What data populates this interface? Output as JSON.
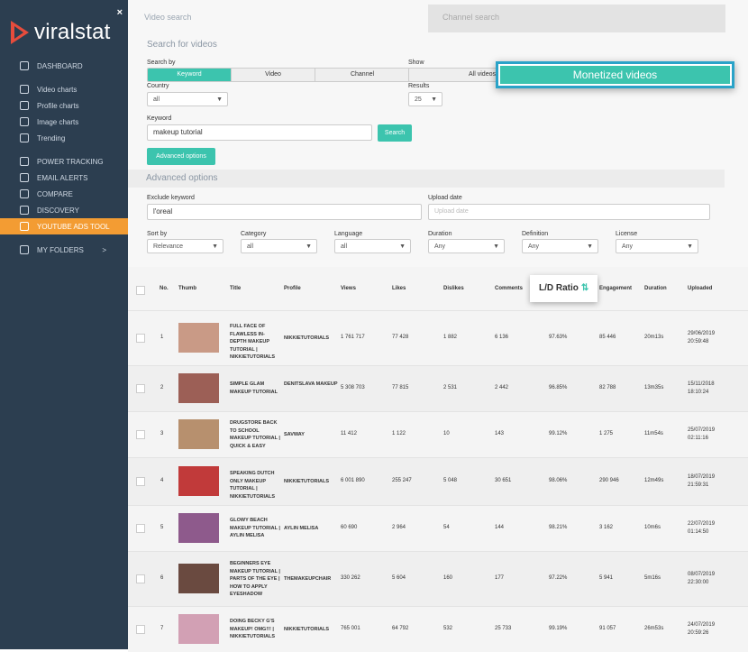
{
  "sidebar": {
    "logo_text": "viralstat",
    "close_label": "×",
    "items": [
      {
        "label": "DASHBOARD",
        "icon": "dashboard-icon",
        "active": false
      },
      {
        "label": "Video charts",
        "icon": "video-chart-icon",
        "active": false
      },
      {
        "label": "Profile charts",
        "icon": "profile-chart-icon",
        "active": false
      },
      {
        "label": "Image charts",
        "icon": "image-chart-icon",
        "active": false
      },
      {
        "label": "Trending",
        "icon": "trending-icon",
        "active": false
      },
      {
        "label": "POWER TRACKING",
        "icon": "power-icon",
        "active": false
      },
      {
        "label": "EMAIL ALERTS",
        "icon": "mail-icon",
        "active": false
      },
      {
        "label": "COMPARE",
        "icon": "compare-icon",
        "active": false
      },
      {
        "label": "DISCOVERY",
        "icon": "discovery-icon",
        "active": false
      },
      {
        "label": "YOUTUBE ADS TOOL",
        "icon": "youtube-icon",
        "active": true
      },
      {
        "label": "MY FOLDERS",
        "icon": "folder-icon",
        "active": false
      }
    ],
    "folders_arrow": ">"
  },
  "tabs": {
    "video": "Video search",
    "channel": "Channel search"
  },
  "search": {
    "title": "Search for videos",
    "search_by_label": "Search by",
    "search_by_options": [
      "Keyword",
      "Video",
      "Channel"
    ],
    "show_label": "Show",
    "show_options": [
      "All videos"
    ],
    "monetized_label": "Monetized videos",
    "country_label": "Country",
    "country_value": "all",
    "results_label": "Results",
    "results_value": "25",
    "keyword_label": "Keyword",
    "keyword_value": "makeup tutorial",
    "search_button": "Search",
    "advanced_button": "Advanced options"
  },
  "advanced": {
    "title": "Advanced options",
    "exclude_label": "Exclude keyword",
    "exclude_value": "l'oreal",
    "upload_label": "Upload date",
    "upload_placeholder": "Upload date",
    "filters": [
      {
        "label": "Sort by",
        "value": "Relevance"
      },
      {
        "label": "Category",
        "value": "all"
      },
      {
        "label": "Language",
        "value": "all"
      },
      {
        "label": "Duration",
        "value": "Any"
      },
      {
        "label": "Definition",
        "value": "Any"
      },
      {
        "label": "License",
        "value": "Any"
      }
    ]
  },
  "table": {
    "headers": {
      "no": "No.",
      "thumb": "Thumb",
      "title": "Title",
      "profile": "Profile",
      "views": "Views",
      "likes": "Likes",
      "dislikes": "Dislikes",
      "comments": "Comments",
      "ld": "L/D Ratio",
      "engagement": "Engagement",
      "duration": "Duration",
      "uploaded": "Uploaded"
    },
    "rows": [
      {
        "no": "1",
        "title": "FULL FACE OF FLAWLESS IN-DEPTH MAKEUP TUTORIAL | NIKKIETUTORIALS",
        "profile": "NIKKIETUTORIALS",
        "views": "1 761 717",
        "likes": "77 428",
        "dislikes": "1 882",
        "comments": "6 136",
        "ld": "97.63%",
        "engagement": "85 446",
        "duration": "20m13s",
        "uploaded_date": "29/06/2019",
        "uploaded_time": "20:59:48",
        "thumb_color": "#c99a86"
      },
      {
        "no": "2",
        "title": "SIMPLE GLAM MAKEUP TUTORIAL",
        "profile": "DENITSLAVA MAKEUP",
        "views": "5 308 703",
        "likes": "77 815",
        "dislikes": "2 531",
        "comments": "2 442",
        "ld": "96.85%",
        "engagement": "82 788",
        "duration": "13m35s",
        "uploaded_date": "15/11/2018",
        "uploaded_time": "18:10:24",
        "thumb_color": "#9c5f56"
      },
      {
        "no": "3",
        "title": "DRUGSTORE BACK TO SCHOOL MAKEUP TUTORIAL | QUICK & EASY",
        "profile": "SAVWAY",
        "views": "11 412",
        "likes": "1 122",
        "dislikes": "10",
        "comments": "143",
        "ld": "99.12%",
        "engagement": "1 275",
        "duration": "11m54s",
        "uploaded_date": "25/07/2019",
        "uploaded_time": "02:11:16",
        "thumb_color": "#b7906e"
      },
      {
        "no": "4",
        "title": "SPEAKING DUTCH ONLY MAKEUP TUTORIAL | NIKKIETUTORIALS",
        "profile": "NIKKIETUTORIALS",
        "views": "6 001 890",
        "likes": "255 247",
        "dislikes": "5 048",
        "comments": "30 651",
        "ld": "98.06%",
        "engagement": "290 946",
        "duration": "12m49s",
        "uploaded_date": "18/07/2019",
        "uploaded_time": "21:59:31",
        "thumb_color": "#c13a3a"
      },
      {
        "no": "5",
        "title": "GLOWY BEACH MAKEUP TUTORIAL | AYLIN MELISA",
        "profile": "AYLIN MELISA",
        "views": "60 690",
        "likes": "2 964",
        "dislikes": "54",
        "comments": "144",
        "ld": "98.21%",
        "engagement": "3 162",
        "duration": "10m6s",
        "uploaded_date": "22/07/2019",
        "uploaded_time": "01:14:50",
        "thumb_color": "#8e5a8c"
      },
      {
        "no": "6",
        "title": "BEGINNERS EYE MAKEUP TUTORIAL | PARTS OF THE EYE | HOW TO APPLY EYESHADOW",
        "profile": "THEMAKEUPCHAIR",
        "views": "330 262",
        "likes": "5 604",
        "dislikes": "160",
        "comments": "177",
        "ld": "97.22%",
        "engagement": "5 941",
        "duration": "5m16s",
        "uploaded_date": "08/07/2019",
        "uploaded_time": "22:30:00",
        "thumb_color": "#6a4a40"
      },
      {
        "no": "7",
        "title": "DOING BECKY G'S MAKEUP! OMG!!! | NIKKIETUTORIALS",
        "profile": "NIKKIETUTORIALS",
        "views": "765 001",
        "likes": "64 792",
        "dislikes": "532",
        "comments": "25 733",
        "ld": "99.19%",
        "engagement": "91 057",
        "duration": "26m53s",
        "uploaded_date": "24/07/2019",
        "uploaded_time": "20:59:26",
        "thumb_color": "#d2a0b4"
      }
    ]
  }
}
